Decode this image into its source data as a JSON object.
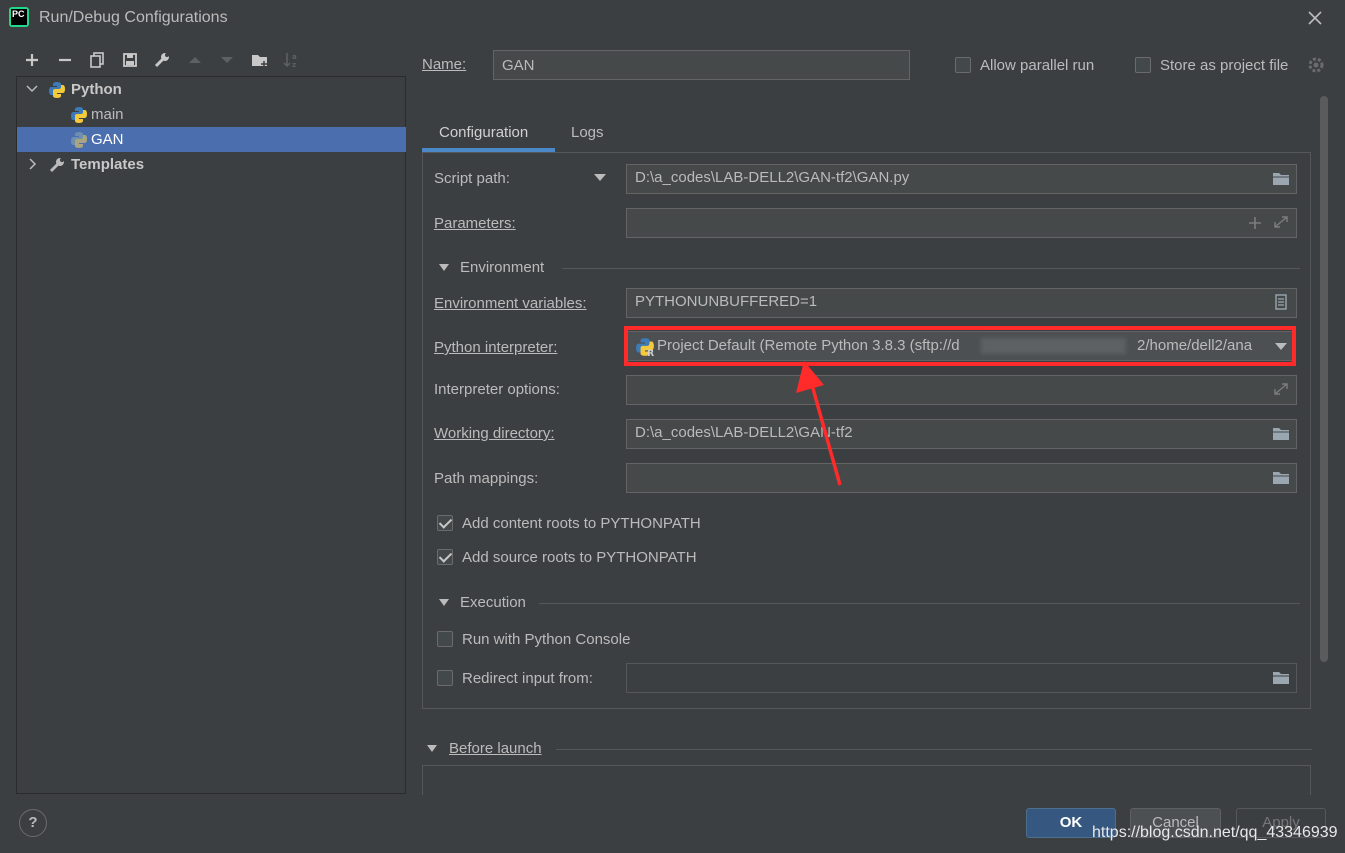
{
  "window": {
    "title": "Run/Debug Configurations"
  },
  "tree": {
    "group_python": "Python",
    "item_main": "main",
    "item_gan": "GAN",
    "group_templates": "Templates"
  },
  "header": {
    "name_label": "Name:",
    "name_value": "GAN",
    "allow_parallel_label": "Allow parallel run",
    "store_project_label": "Store as project file"
  },
  "tabs": {
    "configuration": "Configuration",
    "logs": "Logs"
  },
  "form": {
    "script_path_label": "Script path:",
    "script_path_value": "D:\\a_codes\\LAB-DELL2\\GAN-tf2\\GAN.py",
    "parameters_label": "Parameters:",
    "parameters_value": "",
    "environment_section": "Environment",
    "env_vars_label": "Environment variables:",
    "env_vars_value": "PYTHONUNBUFFERED=1",
    "interpreter_label": "Python interpreter:",
    "interpreter_value": "Project Default (Remote Python 3.8.3 (sftp://d",
    "interpreter_value_tail": "2/home/dell2/ana",
    "interpreter_options_label": "Interpreter options:",
    "interpreter_options_value": "",
    "working_dir_label": "Working directory:",
    "working_dir_value": "D:\\a_codes\\LAB-DELL2\\GAN-tf2",
    "path_mappings_label": "Path mappings:",
    "path_mappings_value": "",
    "add_content_roots_label": "Add content roots to PYTHONPATH",
    "add_source_roots_label": "Add source roots to PYTHONPATH",
    "execution_section": "Execution",
    "run_console_label": "Run with Python Console",
    "redirect_input_label": "Redirect input from:",
    "redirect_input_value": ""
  },
  "before_launch": {
    "label": "Before launch"
  },
  "buttons": {
    "ok": "OK",
    "cancel": "Cancel",
    "apply": "Apply",
    "help": "?"
  },
  "watermark": "https://blog.csdn.net/qq_43346939",
  "colors": {
    "background": "#3c3f41",
    "selection": "#4b6eaf",
    "annotation_red": "#ff2a2a",
    "ok_button": "#365880"
  }
}
